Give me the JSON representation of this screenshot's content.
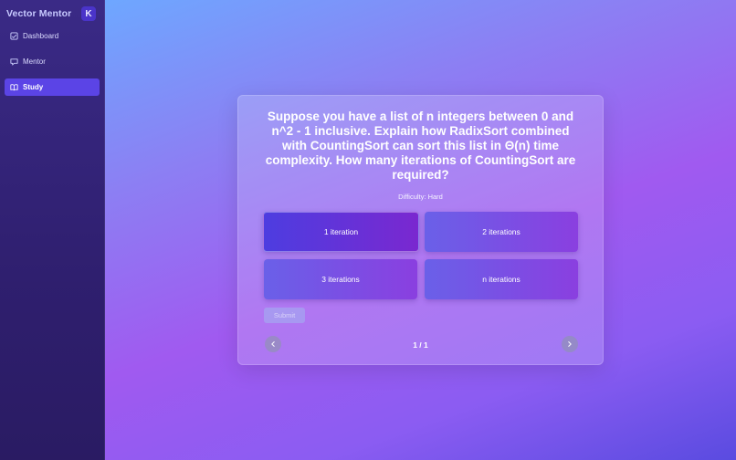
{
  "sidebar": {
    "brand_title": "Vector Mentor",
    "toggle_glyph": "K",
    "items": [
      {
        "label": "Dashboard",
        "icon": "dashboard-icon",
        "active": false
      },
      {
        "label": "Mentor",
        "icon": "chat-icon",
        "active": false
      },
      {
        "label": "Study",
        "icon": "book-icon",
        "active": true
      }
    ]
  },
  "quiz": {
    "question": "Suppose you have a list of n integers between 0 and n^2 - 1 inclusive. Explain how RadixSort combined with CountingSort can sort this list in Θ(n) time complexity. How many iterations of CountingSort are required?",
    "difficulty_label": "Difficulty:",
    "difficulty_value": "Hard",
    "options": [
      "1 iteration",
      "2 iterations",
      "3 iterations",
      "n iterations"
    ],
    "selected_index": 0,
    "submit_label": "Submit",
    "page_indicator": "1 / 1"
  },
  "colors": {
    "accent": "#5b44e6",
    "sidebar_bg": "#2f1f6f"
  }
}
